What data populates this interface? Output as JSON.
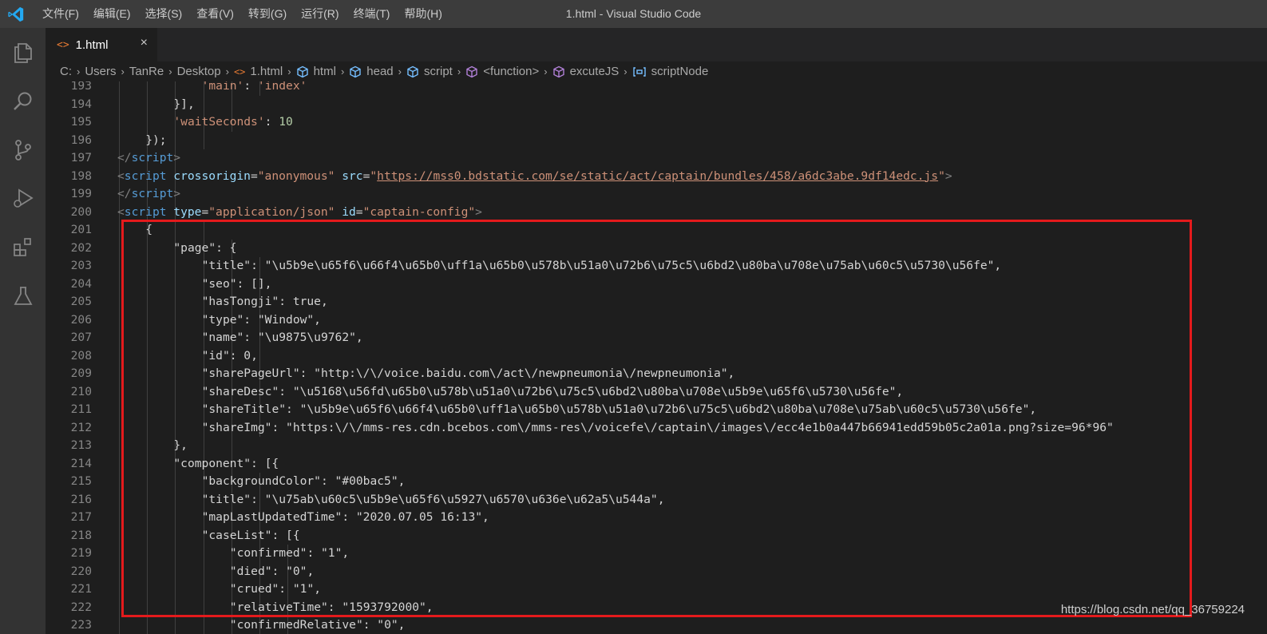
{
  "window": {
    "title": "1.html - Visual Studio Code"
  },
  "menu": [
    "文件(F)",
    "编辑(E)",
    "选择(S)",
    "查看(V)",
    "转到(G)",
    "运行(R)",
    "终端(T)",
    "帮助(H)"
  ],
  "activity_icons": [
    "files-icon",
    "search-icon",
    "source-control-icon",
    "run-debug-icon",
    "extensions-icon",
    "testing-flask-icon"
  ],
  "tab": {
    "icon_text": "<>",
    "label": "1.html",
    "close": "×"
  },
  "breadcrumbs": [
    {
      "label": "C:",
      "icon": ""
    },
    {
      "label": "Users",
      "icon": ""
    },
    {
      "label": "TanRe",
      "icon": ""
    },
    {
      "label": "Desktop",
      "icon": ""
    },
    {
      "label": "1.html",
      "icon": "html-file-icon"
    },
    {
      "label": "html",
      "icon": "element-icon"
    },
    {
      "label": "head",
      "icon": "element-icon"
    },
    {
      "label": "script",
      "icon": "element-icon"
    },
    {
      "label": "<function>",
      "icon": "method-icon"
    },
    {
      "label": "excuteJS",
      "icon": "method-icon"
    },
    {
      "label": "scriptNode",
      "icon": "variable-icon"
    }
  ],
  "code_lines": [
    {
      "n": "193",
      "tokens": [
        [
          "'main'",
          "t-str"
        ],
        [
          ": ",
          "t-plain"
        ],
        [
          "'index'",
          "t-str"
        ]
      ],
      "indent": 28
    },
    {
      "n": "194",
      "tokens": [
        [
          "}],",
          "t-plain"
        ]
      ],
      "indent": 24
    },
    {
      "n": "195",
      "tokens": [
        [
          "'waitSeconds'",
          "t-str"
        ],
        [
          ": ",
          "t-plain"
        ],
        [
          "10",
          "t-num"
        ]
      ],
      "indent": 24
    },
    {
      "n": "196",
      "tokens": [
        [
          "});",
          "t-plain"
        ]
      ],
      "indent": 20
    },
    {
      "n": "197",
      "tokens": [
        [
          "</",
          "t-punct"
        ],
        [
          "script",
          "t-tag"
        ],
        [
          ">",
          "t-punct"
        ]
      ],
      "indent": 16
    },
    {
      "n": "198",
      "tokens": [
        [
          "<",
          "t-punct"
        ],
        [
          "script",
          "t-tag"
        ],
        [
          " crossorigin",
          "t-attr"
        ],
        [
          "=",
          "t-plain"
        ],
        [
          "\"anonymous\"",
          "t-str"
        ],
        [
          " src",
          "t-attr"
        ],
        [
          "=",
          "t-plain"
        ],
        [
          "\"",
          "t-str"
        ],
        [
          "https://mss0.bdstatic.com/se/static/act/captain/bundles/458/a6dc3abe.9df14edc.js",
          "t-url"
        ],
        [
          "\"",
          "t-str"
        ],
        [
          ">",
          "t-punct"
        ]
      ],
      "indent": 16
    },
    {
      "n": "199",
      "tokens": [
        [
          "</",
          "t-punct"
        ],
        [
          "script",
          "t-tag"
        ],
        [
          ">",
          "t-punct"
        ]
      ],
      "indent": 16
    },
    {
      "n": "200",
      "tokens": [
        [
          "<",
          "t-punct"
        ],
        [
          "script",
          "t-tag"
        ],
        [
          " type",
          "t-attr"
        ],
        [
          "=",
          "t-plain"
        ],
        [
          "\"application/json\"",
          "t-str"
        ],
        [
          " id",
          "t-attr"
        ],
        [
          "=",
          "t-plain"
        ],
        [
          "\"captain-config\"",
          "t-str"
        ],
        [
          ">",
          "t-punct"
        ]
      ],
      "indent": 16
    },
    {
      "n": "201",
      "tokens": [
        [
          "{",
          "t-plain"
        ]
      ],
      "indent": 20
    },
    {
      "n": "202",
      "tokens": [
        [
          "\"page\": {",
          "t-plain"
        ]
      ],
      "indent": 24
    },
    {
      "n": "203",
      "tokens": [
        [
          "\"title\": \"\\u5b9e\\u65f6\\u66f4\\u65b0\\uff1a\\u65b0\\u578b\\u51a0\\u72b6\\u75c5\\u6bd2\\u80ba\\u708e\\u75ab\\u60c5\\u5730\\u56fe\",",
          "t-plain"
        ]
      ],
      "indent": 28
    },
    {
      "n": "204",
      "tokens": [
        [
          "\"seo\": [],",
          "t-plain"
        ]
      ],
      "indent": 28
    },
    {
      "n": "205",
      "tokens": [
        [
          "\"hasTongji\": true,",
          "t-plain"
        ]
      ],
      "indent": 28
    },
    {
      "n": "206",
      "tokens": [
        [
          "\"type\": \"Window\",",
          "t-plain"
        ]
      ],
      "indent": 28
    },
    {
      "n": "207",
      "tokens": [
        [
          "\"name\": \"\\u9875\\u9762\",",
          "t-plain"
        ]
      ],
      "indent": 28
    },
    {
      "n": "208",
      "tokens": [
        [
          "\"id\": 0,",
          "t-plain"
        ]
      ],
      "indent": 28
    },
    {
      "n": "209",
      "tokens": [
        [
          "\"sharePageUrl\": \"http:\\/\\/voice.baidu.com\\/act\\/newpneumonia\\/newpneumonia\",",
          "t-plain"
        ]
      ],
      "indent": 28
    },
    {
      "n": "210",
      "tokens": [
        [
          "\"shareDesc\": \"\\u5168\\u56fd\\u65b0\\u578b\\u51a0\\u72b6\\u75c5\\u6bd2\\u80ba\\u708e\\u5b9e\\u65f6\\u5730\\u56fe\",",
          "t-plain"
        ]
      ],
      "indent": 28
    },
    {
      "n": "211",
      "tokens": [
        [
          "\"shareTitle\": \"\\u5b9e\\u65f6\\u66f4\\u65b0\\uff1a\\u65b0\\u578b\\u51a0\\u72b6\\u75c5\\u6bd2\\u80ba\\u708e\\u75ab\\u60c5\\u5730\\u56fe\",",
          "t-plain"
        ]
      ],
      "indent": 28
    },
    {
      "n": "212",
      "tokens": [
        [
          "\"shareImg\": \"https:\\/\\/mms-res.cdn.bcebos.com\\/mms-res\\/voicefe\\/captain\\/images\\/ecc4e1b0a447b66941edd59b05c2a01a.png?size=96*96\"",
          "t-plain"
        ]
      ],
      "indent": 28
    },
    {
      "n": "213",
      "tokens": [
        [
          "},",
          "t-plain"
        ]
      ],
      "indent": 24
    },
    {
      "n": "214",
      "tokens": [
        [
          "\"component\": [{",
          "t-plain"
        ]
      ],
      "indent": 24
    },
    {
      "n": "215",
      "tokens": [
        [
          "\"backgroundColor\": \"#00bac5\",",
          "t-plain"
        ]
      ],
      "indent": 28
    },
    {
      "n": "216",
      "tokens": [
        [
          "\"title\": \"\\u75ab\\u60c5\\u5b9e\\u65f6\\u5927\\u6570\\u636e\\u62a5\\u544a\",",
          "t-plain"
        ]
      ],
      "indent": 28
    },
    {
      "n": "217",
      "tokens": [
        [
          "\"mapLastUpdatedTime\": \"2020.07.05 16:13\",",
          "t-plain"
        ]
      ],
      "indent": 28
    },
    {
      "n": "218",
      "tokens": [
        [
          "\"caseList\": [{",
          "t-plain"
        ]
      ],
      "indent": 28
    },
    {
      "n": "219",
      "tokens": [
        [
          "\"confirmed\": \"1\",",
          "t-plain"
        ]
      ],
      "indent": 32
    },
    {
      "n": "220",
      "tokens": [
        [
          "\"died\": \"0\",",
          "t-plain"
        ]
      ],
      "indent": 32
    },
    {
      "n": "221",
      "tokens": [
        [
          "\"crued\": \"1\",",
          "t-plain"
        ]
      ],
      "indent": 32
    },
    {
      "n": "222",
      "tokens": [
        [
          "\"relativeTime\": \"1593792000\",",
          "t-plain"
        ]
      ],
      "indent": 32
    },
    {
      "n": "223",
      "tokens": [
        [
          "\"confirmedRelative\": \"0\",",
          "t-plain"
        ]
      ],
      "indent": 32
    }
  ],
  "watermark": "https://blog.csdn.net/qq_36759224",
  "colors": {
    "highlight_box": "#e41a1c",
    "tag": "#569cd6",
    "attr": "#9cdcfe",
    "string": "#ce9178",
    "number": "#b5cea8"
  }
}
